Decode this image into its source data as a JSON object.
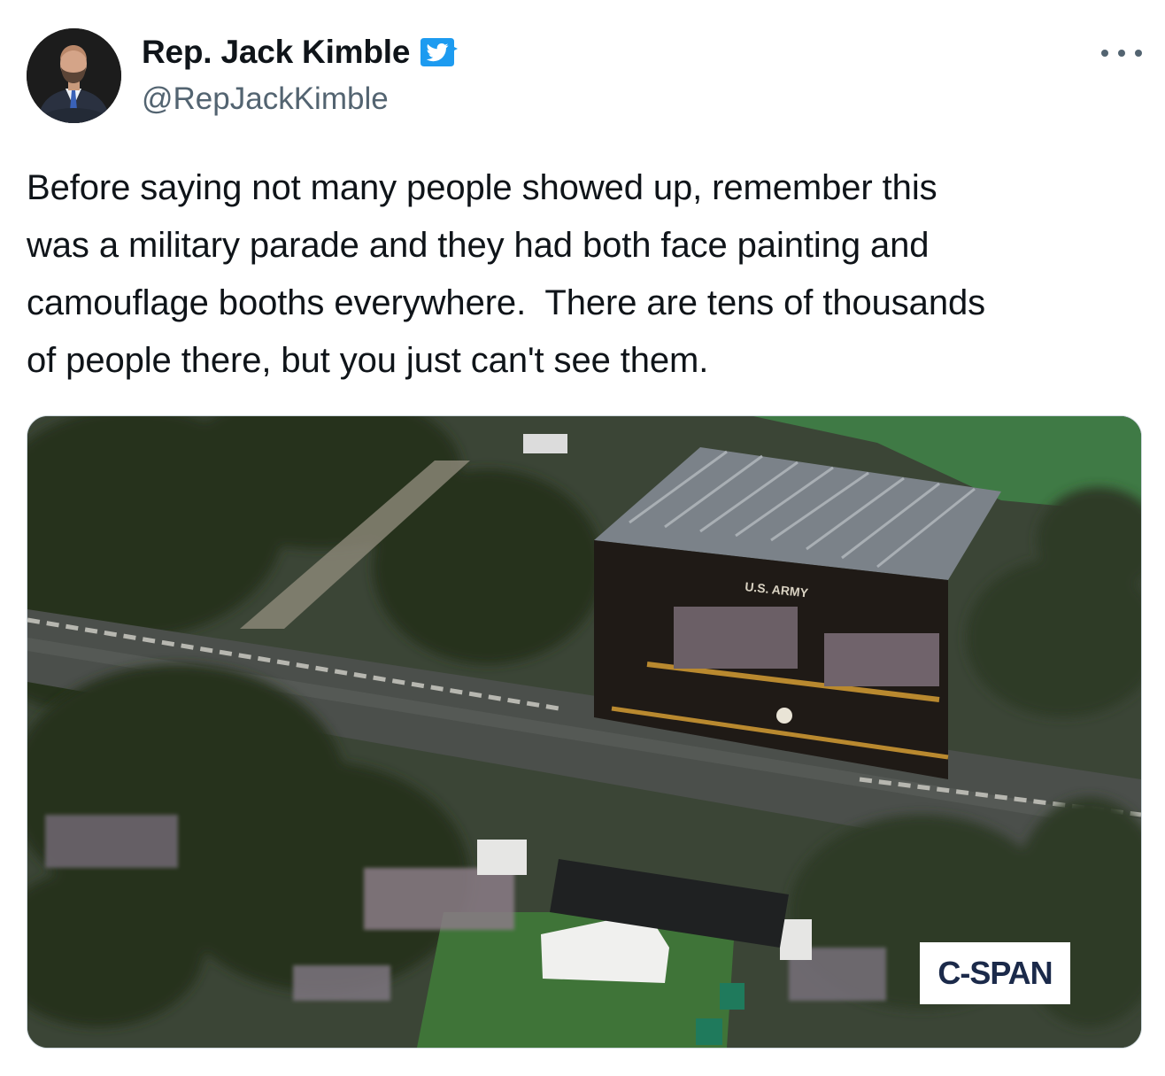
{
  "author": {
    "display_name": "Rep. Jack Kimble",
    "handle": "@RepJackKimble",
    "verified": true
  },
  "tweet": {
    "text": "Before saying not many people showed up, remember this\nwas a military parade and they had both face painting and\ncamouflage booths everywhere.  There are tens of thousands\nof people there, but you just can't see them."
  },
  "media": {
    "stage_sign": "U.S. ARMY",
    "watermark": "C-SPAN"
  },
  "colors": {
    "text": "#0f1419",
    "secondary": "#536471",
    "verified": "#1d9bf0",
    "border": "#cfd9de"
  },
  "icons": {
    "verified": "verified-badge-icon",
    "more": "more-options-icon"
  }
}
